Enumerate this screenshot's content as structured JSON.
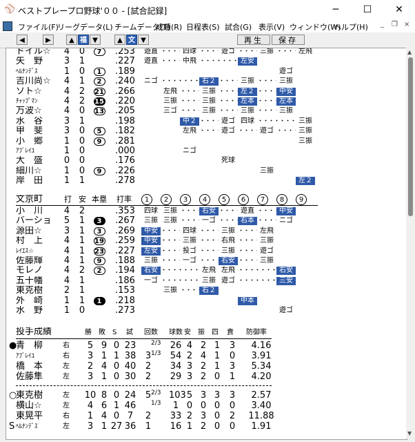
{
  "window": {
    "title": "ベストプレープロ野球'００ - [試合記録]",
    "icon": "baseball-app-icon",
    "controls": {
      "minimize": "─",
      "maximize": "☐",
      "close": "✕"
    }
  },
  "menu": {
    "items": [
      "ファイル(F)",
      "リーグデータ(L)",
      "チームデータ(T)",
      "成績(R)",
      "日程表(S)",
      "試合(G)",
      "表示(V)",
      "ウィンドウ(W)",
      "ヘルプ(H)"
    ],
    "mdi": {
      "minimize": "_",
      "restore": "❐",
      "close": "×"
    }
  },
  "toolbar": {
    "prev_label": "◀",
    "next_label": "▶",
    "team1_up": "▲",
    "team1_name": "福",
    "team1_down": "▼",
    "team2_up": "▲",
    "team2_name": "文",
    "team2_down": "▼",
    "play_label": "再生",
    "save_label": "保存"
  },
  "colors": {
    "hit_bg": "#2f5aa8",
    "hit_fg": "#ffffff"
  },
  "away_batting": {
    "rows": [
      {
        "name": "ドイル☆",
        "small": false,
        "ab": "4",
        "h": "0",
        "hr": "7",
        "hr_filled": false,
        "avg": ".253",
        "pa": [
          "遊直",
          "",
          "四球",
          "",
          "遊ゴ",
          "",
          "三振",
          "",
          "左飛"
        ],
        "hits": []
      },
      {
        "name": "矢　野",
        "small": false,
        "ab": "3",
        "h": "1",
        "hr": "",
        "hr_filled": false,
        "avg": ".227",
        "pa": [
          "遊直",
          "",
          "中飛",
          "",
          "",
          "左安",
          "",
          "",
          ""
        ],
        "hits": [
          5
        ]
      },
      {
        "name": "ﾍﾙﾅﾝﾃﾞｽ",
        "small": true,
        "ab": "1",
        "h": "0",
        "hr": "1",
        "hr_filled": false,
        "avg": ".189",
        "pa": [
          "",
          "",
          "",
          "",
          "",
          "",
          "",
          "遊ゴ",
          ""
        ],
        "hits": []
      },
      {
        "name": "吉川尚☆",
        "small": false,
        "ab": "4",
        "h": "1",
        "hr": "2",
        "hr_filled": false,
        "avg": ".240",
        "pa": [
          "ニゴ",
          "",
          "",
          "右２",
          "",
          "三振",
          "",
          "三振",
          ""
        ],
        "hits": [
          3
        ]
      },
      {
        "name": "ソト☆",
        "small": false,
        "ab": "4",
        "h": "2",
        "hr": "21",
        "hr_filled": false,
        "avg": ".266",
        "pa": [
          "",
          "左飛",
          "",
          "三振",
          "",
          "左２",
          "",
          "中安",
          ""
        ],
        "hits": [
          5,
          7
        ]
      },
      {
        "name": "ﾁｬｯﾌﾟﾏﾝ",
        "small": true,
        "ab": "4",
        "h": "2",
        "hr": "15",
        "hr_filled": true,
        "avg": ".220",
        "pa": [
          "",
          "三振",
          "",
          "三振",
          "",
          "左本",
          "",
          "左本",
          ""
        ],
        "hits": [
          5,
          7
        ]
      },
      {
        "name": "万波☆",
        "small": false,
        "ab": "4",
        "h": "0",
        "hr": "13",
        "hr_filled": false,
        "avg": ".205",
        "pa": [
          "",
          "三ゴ",
          "",
          "三振",
          "",
          "三振",
          "",
          "三振",
          ""
        ],
        "hits": []
      },
      {
        "name": "水　谷",
        "small": false,
        "ab": "3",
        "h": "1",
        "hr": "",
        "hr_filled": false,
        "avg": ".198",
        "pa": [
          "",
          "",
          "中２",
          "",
          "遊ゴ",
          "四球",
          "",
          "",
          "三振"
        ],
        "hits": [
          2
        ]
      },
      {
        "name": "甲　斐",
        "small": false,
        "ab": "3",
        "h": "0",
        "hr": "5",
        "hr_filled": false,
        "avg": ".182",
        "pa": [
          "",
          "",
          "左飛",
          "",
          "遊ゴ",
          "",
          "遊ゴ",
          "",
          "三振"
        ],
        "hits": []
      },
      {
        "name": "小　郷",
        "small": false,
        "ab": "1",
        "h": "0",
        "hr": "9",
        "hr_filled": false,
        "avg": ".281",
        "pa": [
          "",
          "",
          "",
          "",
          "",
          "",
          "",
          "",
          "三振"
        ],
        "hits": []
      },
      {
        "name": "ｱﾌﾞﾚｲﾕ",
        "small": true,
        "ab": "1",
        "h": "0",
        "hr": "",
        "hr_filled": false,
        "avg": ".000",
        "pa": [
          "",
          "",
          "ニゴ",
          "",
          "",
          "",
          "",
          "",
          ""
        ],
        "hits": []
      },
      {
        "name": "大　盛",
        "small": false,
        "ab": "0",
        "h": "0",
        "hr": "",
        "hr_filled": false,
        "avg": ".176",
        "pa": [
          "",
          "",
          "",
          "",
          "死球",
          "",
          "",
          "",
          ""
        ],
        "hits": []
      },
      {
        "name": "細川☆",
        "small": false,
        "ab": "1",
        "h": "0",
        "hr": "9",
        "hr_filled": false,
        "avg": ".226",
        "pa": [
          "",
          "",
          "",
          "",
          "",
          "",
          "三振",
          "",
          ""
        ],
        "hits": []
      },
      {
        "name": "岸　田",
        "small": false,
        "ab": "1",
        "h": "1",
        "hr": "",
        "hr_filled": false,
        "avg": ".278",
        "pa": [
          "",
          "",
          "",
          "",
          "",
          "",
          "",
          "",
          "左２"
        ],
        "hits": [
          8
        ]
      }
    ]
  },
  "home_batting": {
    "team": "文京町",
    "headers": {
      "ab": "打",
      "h": "安",
      "hr": "本塁",
      "avg": "打率",
      "innings": [
        "1",
        "2",
        "3",
        "4",
        "5",
        "6",
        "7",
        "8",
        "9"
      ]
    },
    "rows": [
      {
        "name": "小　川",
        "small": false,
        "ab": "4",
        "h": "2",
        "hr": "",
        "hr_filled": false,
        "avg": ".353",
        "pa": [
          "四球",
          "三振",
          "",
          "右安",
          "",
          "遊直",
          "",
          "中安",
          ""
        ],
        "hits": [
          3,
          7
        ]
      },
      {
        "name": "バーショ",
        "small": false,
        "ab": "5",
        "h": "1",
        "hr": "3",
        "hr_filled": true,
        "avg": ".267",
        "pa": [
          "三振",
          "三振",
          "",
          "一ゴ",
          "",
          "右本",
          "",
          "ニゴ",
          ""
        ],
        "hits": [
          5
        ]
      },
      {
        "name": "源田☆",
        "small": false,
        "ab": "3",
        "h": "1",
        "hr": "3",
        "hr_filled": false,
        "avg": ".269",
        "pa": [
          "中安",
          "",
          "四球",
          "",
          "三振",
          "",
          "左飛",
          "",
          ""
        ],
        "hits": [
          0
        ]
      },
      {
        "name": "村　上",
        "small": false,
        "ab": "4",
        "h": "1",
        "hr": "19",
        "hr_filled": false,
        "avg": ".259",
        "pa": [
          "中安",
          "",
          "三振",
          "",
          "右飛",
          "",
          "三振",
          "",
          ""
        ],
        "hits": [
          0
        ]
      },
      {
        "name": "ﾚｲｴｽ☆",
        "small": true,
        "ab": "4",
        "h": "1",
        "hr": "23",
        "hr_filled": false,
        "avg": ".227",
        "pa": [
          "左安",
          "",
          "投ゴ",
          "",
          "三振",
          "",
          "遊ゴ",
          "",
          ""
        ],
        "hits": [
          0
        ]
      },
      {
        "name": "佐藤輝",
        "small": false,
        "ab": "4",
        "h": "1",
        "hr": "9",
        "hr_filled": false,
        "avg": ".188",
        "pa": [
          "三振",
          "",
          "一ゴ",
          "",
          "右安",
          "",
          "三振",
          "",
          ""
        ],
        "hits": [
          4
        ]
      },
      {
        "name": "モレノ",
        "small": false,
        "ab": "4",
        "h": "2",
        "hr": "2",
        "hr_filled": false,
        "avg": ".194",
        "pa": [
          "右安",
          "",
          "",
          "左飛",
          "左飛",
          "",
          "",
          "右安",
          ""
        ],
        "hits": [
          0,
          7
        ]
      },
      {
        "name": "五十幡",
        "small": false,
        "ab": "4",
        "h": "1",
        "hr": "",
        "hr_filled": false,
        "avg": ".186",
        "pa": [
          "一ゴ",
          "",
          "",
          "三振",
          "遊ゴ",
          "",
          "",
          "三安",
          ""
        ],
        "hits": [
          7
        ]
      },
      {
        "name": "東克樹",
        "small": false,
        "ab": "2",
        "h": "1",
        "hr": "",
        "hr_filled": false,
        "avg": ".153",
        "pa": [
          "",
          "三振",
          "",
          "右２",
          "",
          "",
          "",
          "",
          ""
        ],
        "hits": [
          3
        ]
      },
      {
        "name": "外　崎",
        "small": false,
        "ab": "1",
        "h": "1",
        "hr": "1",
        "hr_filled": true,
        "avg": ".218",
        "pa": [
          "",
          "",
          "",
          "",
          "",
          "中本",
          "",
          "",
          ""
        ],
        "hits": [
          5
        ]
      },
      {
        "name": "水　野",
        "small": false,
        "ab": "1",
        "h": "0",
        "hr": "",
        "hr_filled": false,
        "avg": ".273",
        "pa": [
          "",
          "",
          "",
          "",
          "",
          "",
          "",
          "遊ゴ",
          ""
        ],
        "hits": []
      }
    ]
  },
  "pitching": {
    "title": "投手成績",
    "headers": [
      "勝",
      "敗",
      "S",
      "試",
      "回数",
      "球数",
      "安",
      "振",
      "四",
      "責",
      "防御率"
    ],
    "away": [
      {
        "mark": "●",
        "name": "青　柳",
        "small": false,
        "arm": "右",
        "w": "5",
        "l": "9",
        "s": "0",
        "g": "23",
        "ip": "",
        "ip_frac": "2/3",
        "np": "26",
        "h": "4",
        "so": "2",
        "bb": "1",
        "er": "3",
        "era": "4.16"
      },
      {
        "mark": "",
        "name": "ｱﾌﾞﾚｲﾕ",
        "small": true,
        "arm": "右",
        "w": "3",
        "l": "1",
        "s": "1",
        "g": "38",
        "ip": "3",
        "ip_frac": "1/3",
        "np": "54",
        "h": "2",
        "so": "4",
        "bb": "1",
        "er": "0",
        "era": "3.91"
      },
      {
        "mark": "",
        "name": "橋　本",
        "small": false,
        "arm": "左",
        "w": "2",
        "l": "4",
        "s": "0",
        "g": "40",
        "ip": "2",
        "ip_frac": "",
        "np": "34",
        "h": "3",
        "so": "2",
        "bb": "1",
        "er": "3",
        "era": "5.34"
      },
      {
        "mark": "",
        "name": "佐藤隼",
        "small": false,
        "arm": "左",
        "w": "3",
        "l": "1",
        "s": "0",
        "g": "30",
        "ip": "2",
        "ip_frac": "",
        "np": "29",
        "h": "3",
        "so": "2",
        "bb": "0",
        "er": "1",
        "era": "4.20"
      }
    ],
    "home": [
      {
        "mark": "○",
        "name": "東克樹",
        "small": false,
        "arm": "左",
        "w": "10",
        "l": "8",
        "s": "0",
        "g": "24",
        "ip": "5",
        "ip_frac": "2/3",
        "np": "103",
        "h": "5",
        "so": "3",
        "bb": "3",
        "er": "3",
        "era": "2.57"
      },
      {
        "mark": "",
        "name": "横山☆",
        "small": false,
        "arm": "左",
        "w": "4",
        "l": "6",
        "s": "1",
        "g": "46",
        "ip": "",
        "ip_frac": "1/3",
        "np": "1",
        "h": "0",
        "so": "0",
        "bb": "0",
        "er": "0",
        "era": "3.40"
      },
      {
        "mark": "",
        "name": "東晃平",
        "small": false,
        "arm": "右",
        "w": "1",
        "l": "4",
        "s": "0",
        "g": "7",
        "ip": "2",
        "ip_frac": "",
        "np": "33",
        "h": "2",
        "so": "3",
        "bb": "0",
        "er": "2",
        "era": "11.88"
      },
      {
        "mark": "S",
        "name": "ﾍﾙﾅﾝﾃﾞｽ",
        "small": true,
        "arm": "左",
        "w": "3",
        "l": "1",
        "s": "27",
        "g": "36",
        "ip": "1",
        "ip_frac": "",
        "np": "16",
        "h": "1",
        "so": "2",
        "bb": "0",
        "er": "0",
        "era": "1.91"
      }
    ]
  }
}
